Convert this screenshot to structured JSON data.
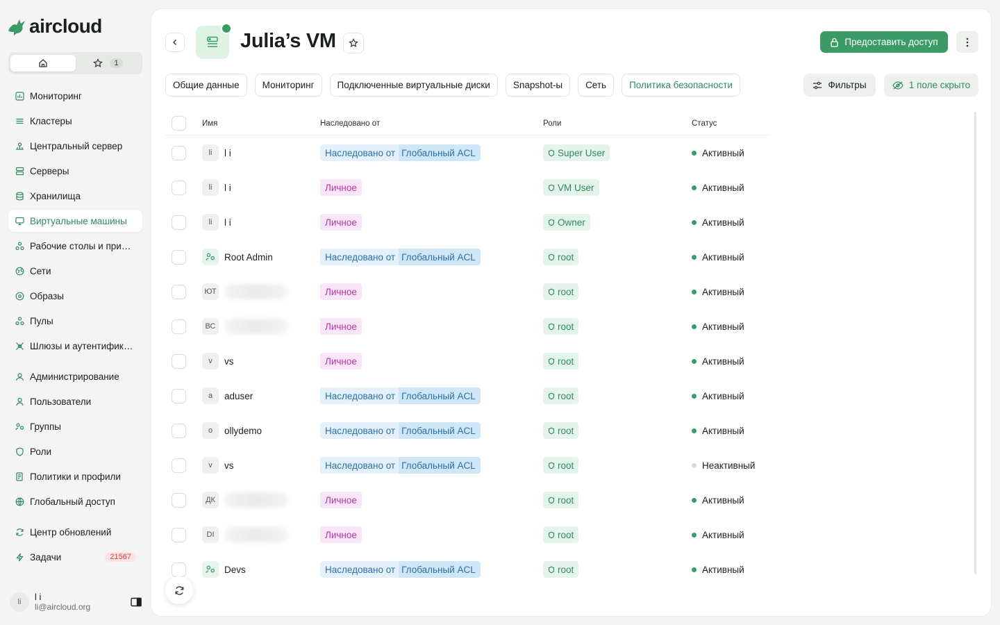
{
  "brand": {
    "name": "aircloud"
  },
  "quick": {
    "fav_count": "1"
  },
  "nav": [
    {
      "label": "Мониторинг",
      "icon": "chart-icon"
    },
    {
      "label": "Кластеры",
      "icon": "layers-icon"
    },
    {
      "label": "Центральный сервер",
      "icon": "hub-icon"
    },
    {
      "label": "Серверы",
      "icon": "server-icon"
    },
    {
      "label": "Хранилища",
      "icon": "database-icon"
    },
    {
      "label": "Виртуальные машины",
      "icon": "monitor-icon"
    },
    {
      "label": "Рабочие столы и приложения",
      "icon": "apps-icon"
    },
    {
      "label": "Сети",
      "icon": "globe-icon"
    },
    {
      "label": "Образы",
      "icon": "disc-icon"
    },
    {
      "label": "Пулы",
      "icon": "pools-icon"
    },
    {
      "label": "Шлюзы и аутентификация",
      "icon": "gateway-icon"
    },
    {
      "label": "Администрирование",
      "icon": "admin-icon"
    },
    {
      "label": "Пользователи",
      "icon": "user-icon"
    },
    {
      "label": "Группы",
      "icon": "group-icon"
    },
    {
      "label": "Роли",
      "icon": "shield-icon"
    },
    {
      "label": "Политики и профили",
      "icon": "policy-icon"
    },
    {
      "label": "Глобальный доступ",
      "icon": "globe-icon"
    },
    {
      "label": "Центр обновлений",
      "icon": "refresh-icon"
    },
    {
      "label": "Задачи",
      "icon": "bolt-icon",
      "badge": "21567"
    }
  ],
  "user": {
    "initials": "li",
    "name": "l i",
    "email": "li@aircloud.org"
  },
  "header": {
    "title": "Julia’s VM",
    "grant_label": "Предоставить доступ"
  },
  "tabs": [
    "Общие данные",
    "Мониторинг",
    "Подключенные виртуальные диски",
    "Snapshot-ы",
    "Сеть",
    "Политика безопасности"
  ],
  "filters_label": "Фильтры",
  "hidden_label": "1 поле скрыто",
  "columns": {
    "name": "Имя",
    "inherited": "Наследовано от",
    "roles": "Роли",
    "status": "Статус"
  },
  "inh_prefix": "Наследовано от",
  "inh_acl": "Глобальный ACL",
  "rows": [
    {
      "init": "li",
      "name": "l i",
      "inh": "acl",
      "role": "Super User",
      "status": "Активный"
    },
    {
      "init": "li",
      "name": "l i",
      "inh": "own",
      "own_label": "Личное",
      "role": "VM User",
      "status": "Активный"
    },
    {
      "init": "li",
      "name": "l i",
      "inh": "own",
      "own_label": "Личное",
      "role": "Owner",
      "status": "Активный"
    },
    {
      "init": "group",
      "name": "Root Admin",
      "inh": "acl",
      "role": "root",
      "status": "Активный"
    },
    {
      "init": "ЮТ",
      "name": "",
      "inh": "own",
      "own_label": "Личное",
      "role": "root",
      "status": "Активный"
    },
    {
      "init": "ВС",
      "name": "",
      "inh": "own",
      "own_label": "Личное",
      "role": "root",
      "status": "Активный"
    },
    {
      "init": "v",
      "name": "vs",
      "inh": "own",
      "own_label": "Личное",
      "role": "root",
      "status": "Активный"
    },
    {
      "init": "a",
      "name": "aduser",
      "inh": "acl",
      "role": "root",
      "status": "Активный"
    },
    {
      "init": "o",
      "name": "ollydemo",
      "inh": "acl",
      "role": "root",
      "status": "Активный"
    },
    {
      "init": "v",
      "name": "vs",
      "inh": "acl",
      "role": "root",
      "status": "Неактивный",
      "inactive": true
    },
    {
      "init": "ДК",
      "name": "",
      "inh": "own",
      "own_label": "Личное",
      "role": "root",
      "status": "Активный"
    },
    {
      "init": "DI",
      "name": "",
      "inh": "own",
      "own_label": "Личное",
      "role": "root",
      "status": "Активный"
    },
    {
      "init": "group",
      "name": "Devs",
      "inh": "acl",
      "role": "root",
      "status": "Активный"
    }
  ],
  "colors": {
    "accent": "#3a9b67",
    "inherit_bg": "#e4f1fb",
    "own_bg": "#f8e5f7"
  }
}
